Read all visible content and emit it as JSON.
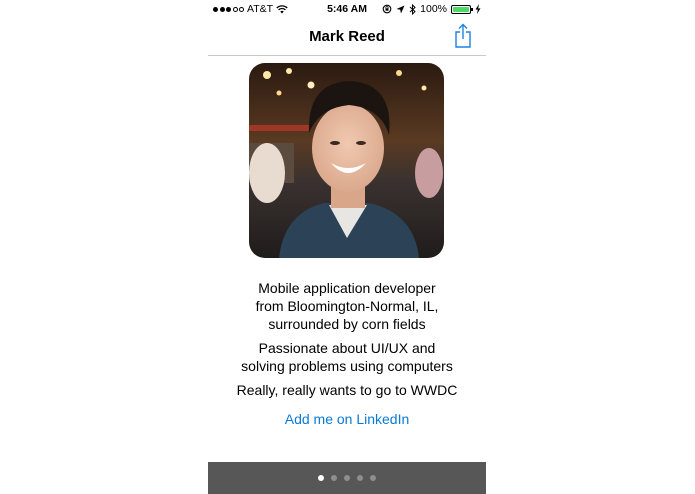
{
  "status_bar": {
    "carrier": "AT&T",
    "time": "5:46 AM",
    "battery": "100%",
    "signal_bars_filled": 3,
    "signal_bars_total": 5
  },
  "navbar": {
    "title": "Mark Reed",
    "share_icon": "share-icon"
  },
  "profile": {
    "photo_icon": "profile-photo"
  },
  "bio": {
    "line1": "Mobile application developer",
    "line2": "from Bloomington-Normal, IL,",
    "line3": "surrounded by corn fields",
    "line4": "Passionate about UI/UX and",
    "line5": "solving problems using computers",
    "line6": "Really, really wants to go to WWDC"
  },
  "link": {
    "label": "Add me on LinkedIn"
  },
  "pager": {
    "page_count": 5,
    "current_page": 1
  },
  "colors": {
    "link": "#0a7ad6",
    "pager_bg": "#575757",
    "battery": "#4cd964"
  }
}
